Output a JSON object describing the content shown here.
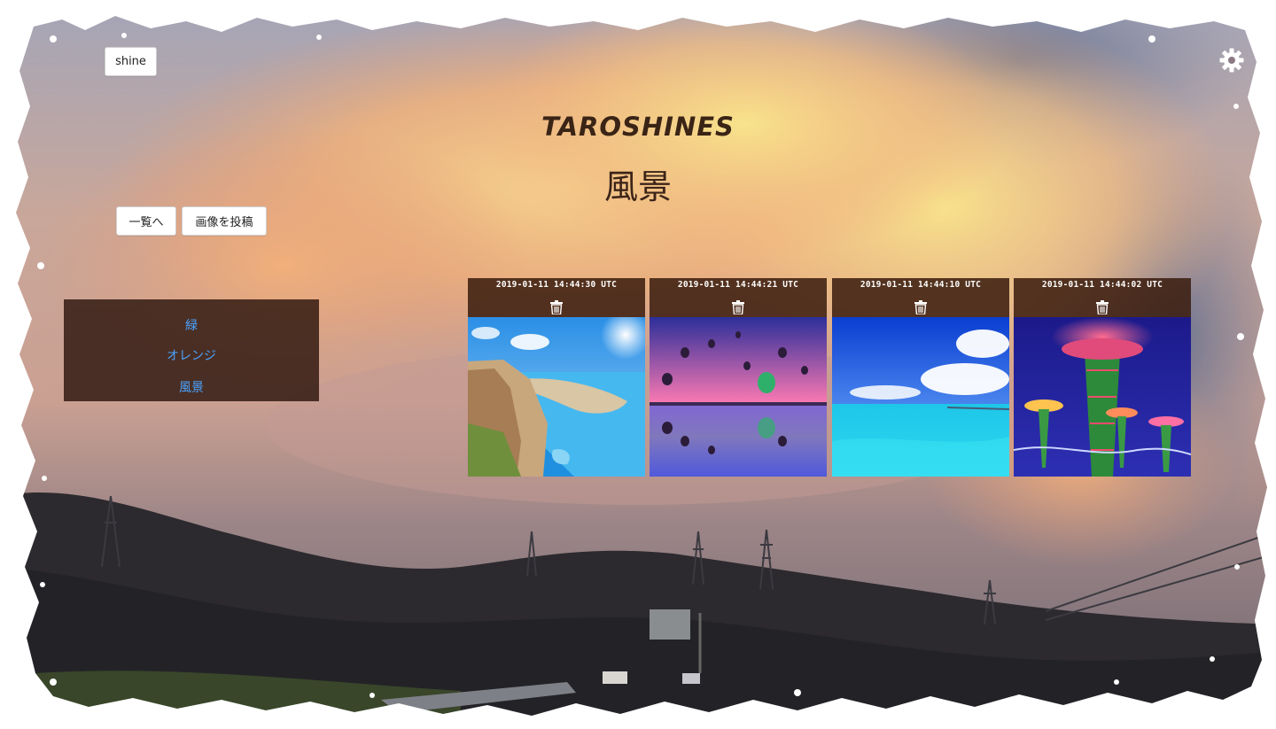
{
  "header": {
    "user_button_label": "shine",
    "settings_icon": "gear-icon",
    "site_title": "TAROSHINES",
    "page_title": "風景"
  },
  "actions": {
    "back_label": "一覧へ",
    "post_label": "画像を投稿"
  },
  "categories": {
    "items": [
      {
        "label": "緑"
      },
      {
        "label": "オレンジ"
      },
      {
        "label": "風景"
      }
    ]
  },
  "gallery": {
    "posts": [
      {
        "date": "2019-01-11 14:44:30 UTC",
        "delete_icon": "trash-icon",
        "photo": "coastal-cliff-beach"
      },
      {
        "date": "2019-01-11 14:44:21 UTC",
        "delete_icon": "trash-icon",
        "photo": "hot-air-balloons-reflection"
      },
      {
        "date": "2019-01-11 14:44:10 UTC",
        "delete_icon": "trash-icon",
        "photo": "blue-sea-bridge"
      },
      {
        "date": "2019-01-11 14:44:02 UTC",
        "delete_icon": "trash-icon",
        "photo": "supertree-grove-night"
      }
    ]
  },
  "colors": {
    "link": "#4aa3ff",
    "panel": "#28120a",
    "title": "#3a2416"
  }
}
